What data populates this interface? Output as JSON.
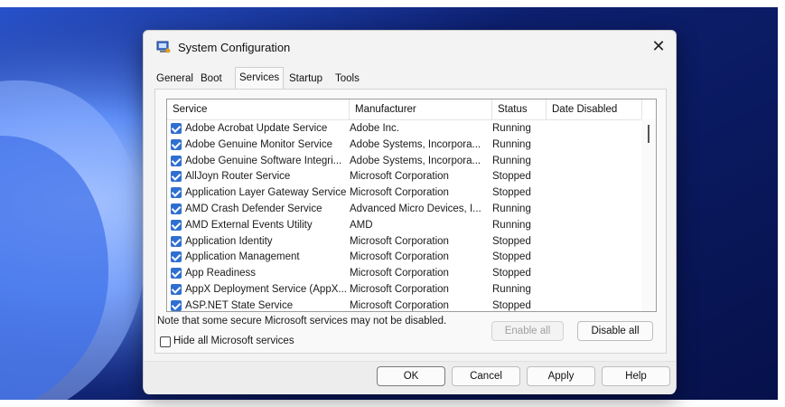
{
  "window": {
    "title": "System Configuration",
    "close_glyph": "✕"
  },
  "tabs": [
    {
      "label": "General"
    },
    {
      "label": "Boot"
    },
    {
      "label": "Services",
      "active": true
    },
    {
      "label": "Startup"
    },
    {
      "label": "Tools"
    }
  ],
  "services_table": {
    "columns": [
      "Service",
      "Manufacturer",
      "Status",
      "Date Disabled"
    ],
    "rows": [
      {
        "service": "Adobe Acrobat Update Service",
        "manufacturer": "Adobe Inc.",
        "status": "Running",
        "date_disabled": ""
      },
      {
        "service": "Adobe Genuine Monitor Service",
        "manufacturer": "Adobe Systems, Incorpora...",
        "status": "Running",
        "date_disabled": ""
      },
      {
        "service": "Adobe Genuine Software Integri...",
        "manufacturer": "Adobe Systems, Incorpora...",
        "status": "Running",
        "date_disabled": ""
      },
      {
        "service": "AllJoyn Router Service",
        "manufacturer": "Microsoft Corporation",
        "status": "Stopped",
        "date_disabled": ""
      },
      {
        "service": "Application Layer Gateway Service",
        "manufacturer": "Microsoft Corporation",
        "status": "Stopped",
        "date_disabled": ""
      },
      {
        "service": "AMD Crash Defender Service",
        "manufacturer": "Advanced Micro Devices, I...",
        "status": "Running",
        "date_disabled": ""
      },
      {
        "service": "AMD External Events Utility",
        "manufacturer": "AMD",
        "status": "Running",
        "date_disabled": ""
      },
      {
        "service": "Application Identity",
        "manufacturer": "Microsoft Corporation",
        "status": "Stopped",
        "date_disabled": ""
      },
      {
        "service": "Application Management",
        "manufacturer": "Microsoft Corporation",
        "status": "Stopped",
        "date_disabled": ""
      },
      {
        "service": "App Readiness",
        "manufacturer": "Microsoft Corporation",
        "status": "Stopped",
        "date_disabled": ""
      },
      {
        "service": "AppX Deployment Service (AppX...",
        "manufacturer": "Microsoft Corporation",
        "status": "Running",
        "date_disabled": ""
      },
      {
        "service": "ASP.NET State Service",
        "manufacturer": "Microsoft Corporation",
        "status": "Stopped",
        "date_disabled": ""
      }
    ]
  },
  "note": "Note that some secure Microsoft services may not be disabled.",
  "enable_all_label": "Enable all",
  "disable_all_label": "Disable all",
  "hide_ms_label": "Hide all Microsoft services",
  "footer": {
    "ok": "OK",
    "cancel": "Cancel",
    "apply": "Apply",
    "help": "Help"
  },
  "colors": {
    "checkbox": "#2f6fd0",
    "wallpaper_dark": "#0b1a6e",
    "wallpaper_light": "#7fa8ff"
  }
}
